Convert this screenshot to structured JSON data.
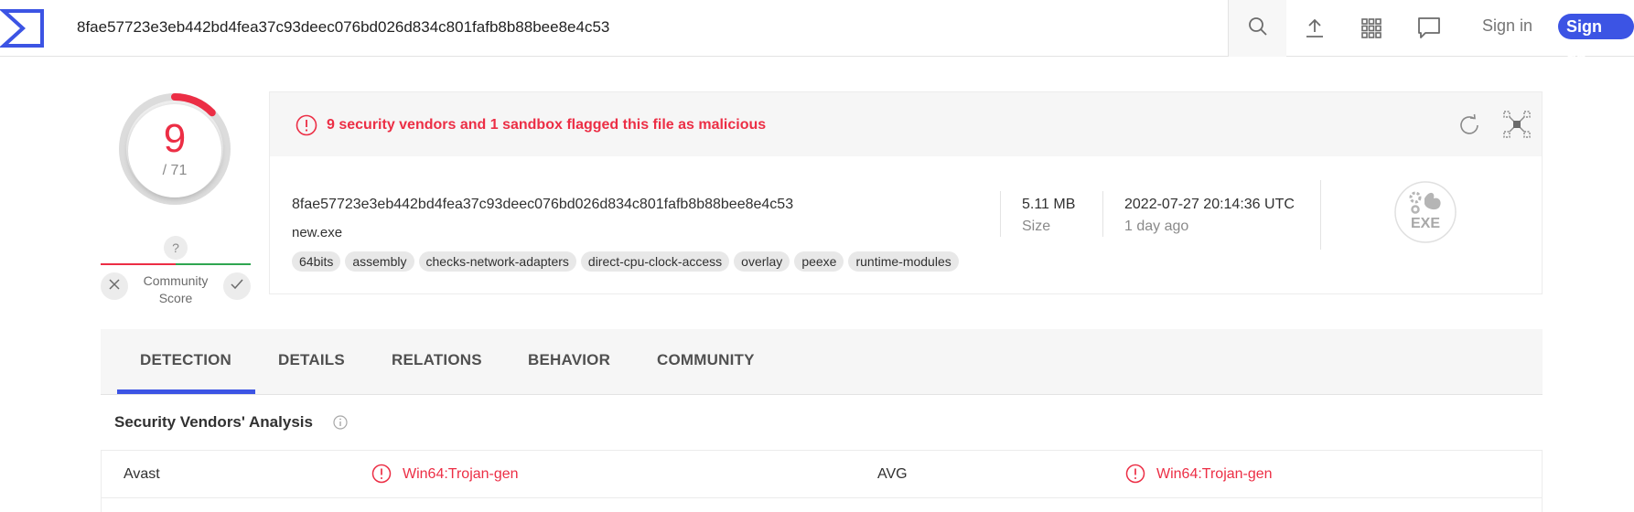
{
  "header": {
    "search_value": "8fae57723e3eb442bd4fea37c93deec076bd026d834c801fafb8b88bee8e4c53",
    "icons": [
      "search-icon",
      "upload-icon",
      "apps-grid-icon",
      "chat-icon"
    ],
    "signin": "Sign in",
    "signup": "Sign up",
    "accent": "#3c54e4"
  },
  "score": {
    "detections": "9",
    "total": "/ 71",
    "fraction": 0.127,
    "community_help": "?",
    "community_label_1": "Community",
    "community_label_2": "Score"
  },
  "summary": {
    "alert": "9 security vendors and 1 sandbox flagged this file as malicious",
    "hash": "8fae57723e3eb442bd4fea37c93deec076bd026d834c801fafb8b88bee8e4c53",
    "filename": "new.exe",
    "tags": [
      "64bits",
      "assembly",
      "checks-network-adapters",
      "direct-cpu-clock-access",
      "overlay",
      "peexe",
      "runtime-modules"
    ],
    "size_value": "5.11 MB",
    "size_label": "Size",
    "date_value": "2022-07-27 20:14:36 UTC",
    "date_ago": "1 day ago",
    "file_type": "EXE",
    "malicious_color": "#ec2e45"
  },
  "tabs": [
    "DETECTION",
    "DETAILS",
    "RELATIONS",
    "BEHAVIOR",
    "COMMUNITY"
  ],
  "vendors": {
    "title": "Security Vendors' Analysis",
    "rows": [
      {
        "left_vendor": "Avast",
        "left_result": "Win64:Trojan-gen",
        "right_vendor": "AVG",
        "right_result": "Win64:Trojan-gen"
      }
    ]
  }
}
